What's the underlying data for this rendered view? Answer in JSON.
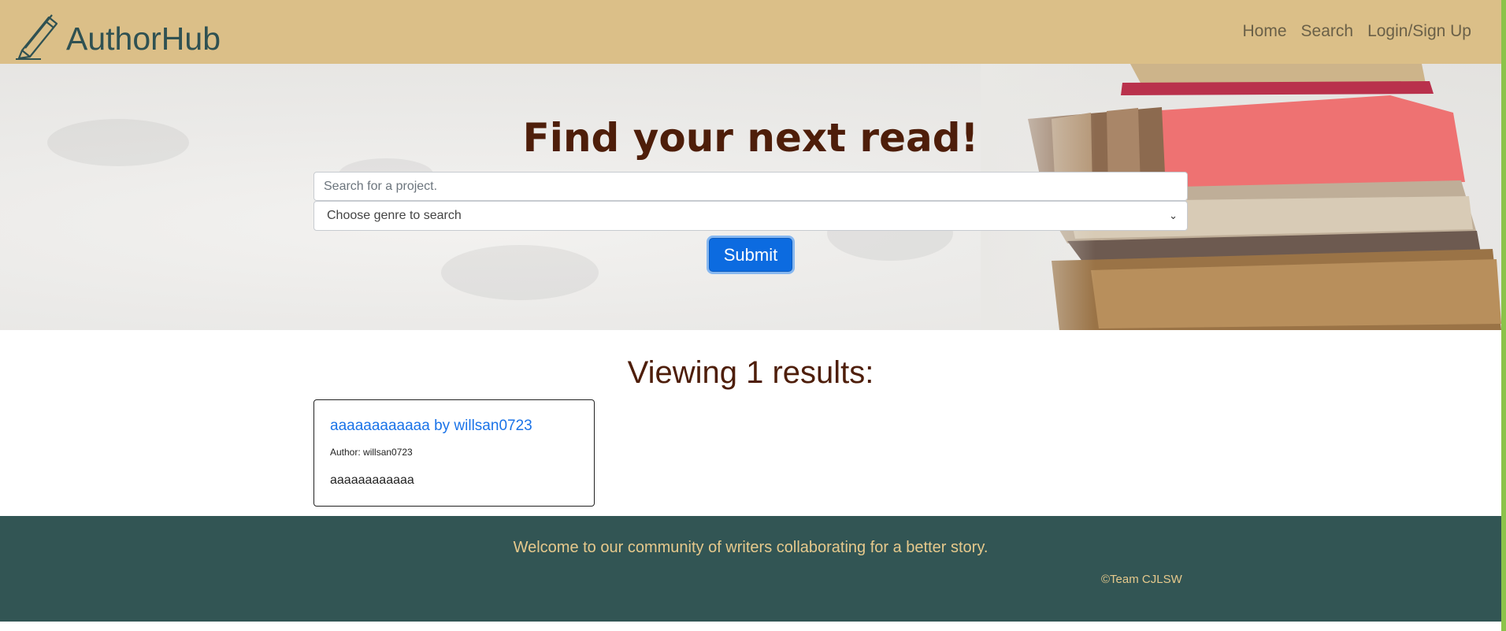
{
  "navbar": {
    "brand": "AuthorHub",
    "links": [
      "Home",
      "Search",
      "Login/Sign Up"
    ]
  },
  "hero": {
    "title": "Find your next read!",
    "search_placeholder": "Search for a project.",
    "genre_select_value": "Choose genre to search",
    "submit_label": "Submit"
  },
  "results": {
    "heading": "Viewing 1 results:",
    "cards": [
      {
        "title": "aaaaaaaaaaaa by willsan0723",
        "author": "Author: willsan0723",
        "description": "aaaaaaaaaaaa"
      }
    ]
  },
  "footer": {
    "message": "Welcome to our community of writers collaborating for a better story.",
    "copyright": "©Team CJLSW"
  },
  "colors": {
    "navbar": "#dbbf88",
    "brand_text": "#2f5152",
    "heading": "#4e1e0a",
    "submit_button": "#0c6be0",
    "card_link": "#1a73e8",
    "footer_bg": "#325554",
    "footer_text": "#e6c98c"
  }
}
